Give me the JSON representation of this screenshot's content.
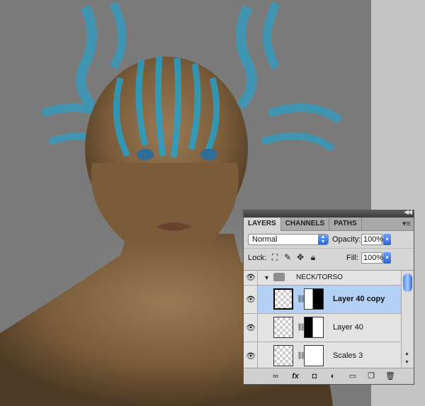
{
  "panel": {
    "tabs": [
      "LAYERS",
      "CHANNELS",
      "PATHS"
    ],
    "active_tab": "LAYERS",
    "blend_mode": "Normal",
    "opacity_label": "Opacity:",
    "opacity_value": "100%",
    "lock_label": "Lock:",
    "fill_label": "Fill:",
    "fill_value": "100%",
    "group": {
      "name": "NECK/TORSO"
    },
    "layers": [
      {
        "name": "Layer 40 copy",
        "selected": true
      },
      {
        "name": "Layer 40",
        "selected": false
      },
      {
        "name": "Scales 3",
        "selected": false
      }
    ],
    "footer_icons": [
      "link-layers-icon",
      "fx-icon",
      "add-mask-icon",
      "adjustment-layer-icon",
      "new-group-icon",
      "new-layer-icon",
      "trash-icon"
    ]
  },
  "colors": {
    "accent": "#3a7bd5",
    "selection": "#b3d0f5",
    "stripe": "#1aa8d8"
  }
}
